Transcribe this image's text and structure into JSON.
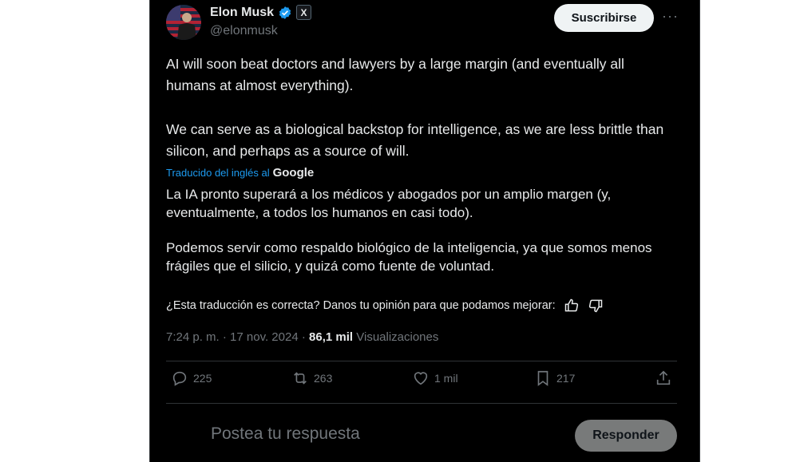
{
  "author": {
    "name": "Elon Musk",
    "handle": "@elonmusk",
    "x_badge": "X"
  },
  "header": {
    "subscribe_label": "Suscribirse",
    "more_label": "···"
  },
  "tweet": {
    "paragraphs": [
      "AI will soon beat doctors and lawyers by a large margin (and eventually all humans at almost everything).",
      "We can serve as a biological backstop for intelligence, as we are less brittle than silicon, and perhaps as a source of will."
    ],
    "translated_label": "Traducido del inglés al",
    "translator": "Google",
    "translated_paragraphs": [
      "La IA pronto superará a los médicos y abogados por un amplio margen (y, eventualmente, a todos los humanos en casi todo).",
      "Podemos servir como respaldo biológico de la inteligencia, ya que somos menos frágiles que el silicio, y quizá como fuente de voluntad."
    ],
    "feedback_question": "¿Esta traducción es correcta? Danos tu opinión para que podamos mejorar:"
  },
  "meta": {
    "time": "7:24 p. m.",
    "separator": "·",
    "date": "17 nov. 2024",
    "views_count": "86,1 mil",
    "views_label": "Visualizaciones"
  },
  "actions": {
    "replies": "225",
    "reposts": "263",
    "likes": "1 mil",
    "bookmarks": "217"
  },
  "reply": {
    "placeholder": "Postea tu respuesta",
    "button_label": "Responder"
  },
  "colors": {
    "background": "#000000",
    "text": "#e7e9ea",
    "muted": "#71767b",
    "accent": "#1d9bf0",
    "divider": "#2f3336"
  }
}
